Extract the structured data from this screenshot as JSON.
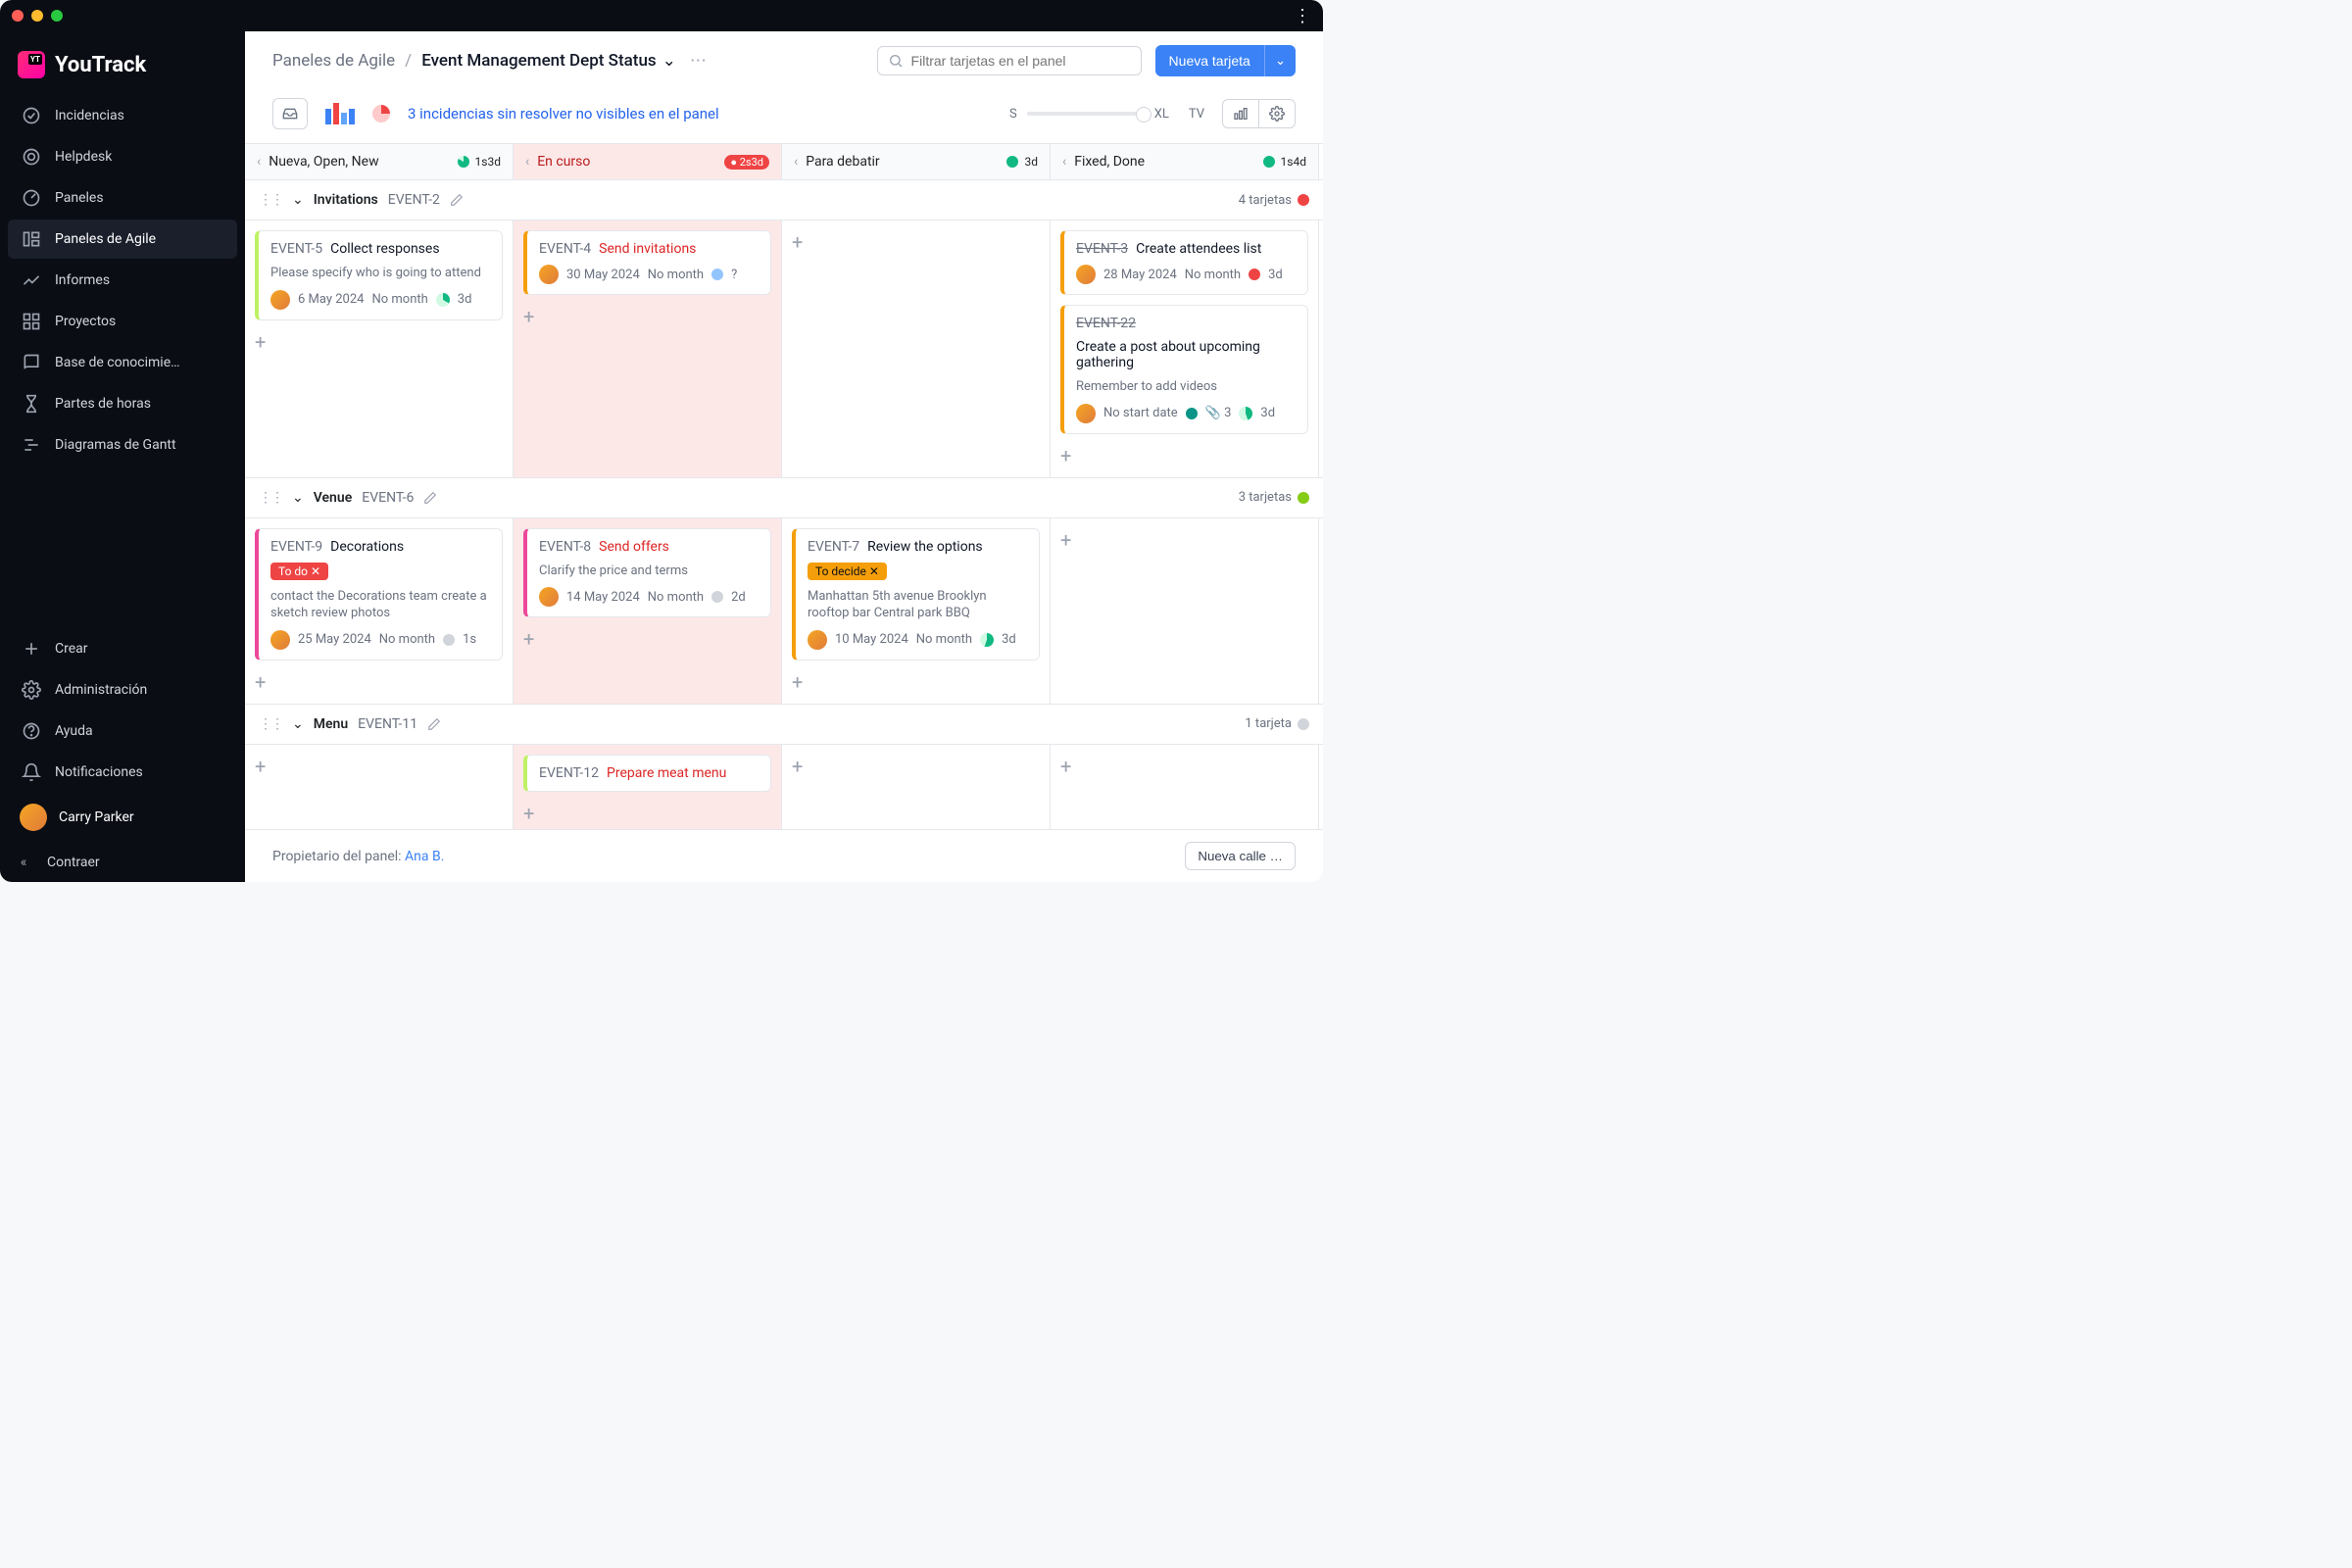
{
  "brand": "YouTrack",
  "sidebar": {
    "items": [
      {
        "label": "Incidencias",
        "icon": "check-circle-icon"
      },
      {
        "label": "Helpdesk",
        "icon": "life-ring-icon"
      },
      {
        "label": "Paneles",
        "icon": "dashboard-icon"
      },
      {
        "label": "Paneles de Agile",
        "icon": "board-icon",
        "active": true
      },
      {
        "label": "Informes",
        "icon": "chart-icon"
      },
      {
        "label": "Proyectos",
        "icon": "grid-icon"
      },
      {
        "label": "Base de conocimie…",
        "icon": "book-icon"
      },
      {
        "label": "Partes de horas",
        "icon": "hourglass-icon"
      },
      {
        "label": "Diagramas de Gantt",
        "icon": "gantt-icon"
      }
    ],
    "bottom": [
      {
        "label": "Crear",
        "icon": "plus-icon"
      },
      {
        "label": "Administración",
        "icon": "gear-icon"
      },
      {
        "label": "Ayuda",
        "icon": "help-icon"
      },
      {
        "label": "Notificaciones",
        "icon": "bell-icon"
      }
    ],
    "user": "Carry Parker",
    "collapse": "Contraer"
  },
  "header": {
    "breadcrumb_parent": "Paneles de Agile",
    "breadcrumb_current": "Event Management Dept Status",
    "search_placeholder": "Filtrar tarjetas en el panel",
    "new_card": "Nueva tarjeta"
  },
  "subbar": {
    "warning": "3 incidencias sin resolver no visibles en el panel",
    "size_s": "S",
    "size_xl": "XL",
    "size_tv": "TV"
  },
  "columns": [
    {
      "title": "Nueva, Open, New",
      "badge": "1s3d",
      "badge_color": "green",
      "pink": false
    },
    {
      "title": "En curso",
      "badge": "2s3d",
      "badge_color": "red",
      "pink": true
    },
    {
      "title": "Para debatir",
      "badge": "3d",
      "badge_color": "green_dot",
      "pink": false
    },
    {
      "title": "Fixed, Done",
      "badge": "1s4d",
      "badge_color": "green_dot",
      "pink": false
    }
  ],
  "swimlanes": [
    {
      "title": "Invitations",
      "id": "EVENT-2",
      "count": "4 tarjetas",
      "count_dot": "red",
      "cells": [
        [
          {
            "id": "EVENT-5",
            "title": "Collect responses",
            "border": "#bef264",
            "desc": "Please specify who is going to attend",
            "date": "6 May 2024",
            "month": "No month",
            "pie": "conic-gradient(#10b981 0 120deg,#d1fae5 120deg 360deg)",
            "est": "3d"
          }
        ],
        [
          {
            "id": "EVENT-4",
            "title": "Send invitations",
            "title_red": true,
            "border": "#f59e0b",
            "date": "30 May 2024",
            "month": "No month",
            "dot": "#93c5fd",
            "est": "?"
          }
        ],
        [],
        [
          {
            "id": "EVENT-3",
            "strike": true,
            "title": "Create attendees list",
            "border": "#f59e0b",
            "date": "28 May 2024",
            "month": "No month",
            "dot": "#ef4444",
            "est": "3d"
          },
          {
            "id": "EVENT-22",
            "strike": true,
            "title": "Create a post about upcoming gathering",
            "border": "#f59e0b",
            "desc": "Remember to add videos",
            "date": "No start date",
            "dot2": "#0d9488",
            "attach": "3",
            "pie": "conic-gradient(#10b981 0 160deg,#d1fae5 160deg 360deg)",
            "est": "3d"
          }
        ]
      ]
    },
    {
      "title": "Venue",
      "id": "EVENT-6",
      "count": "3 tarjetas",
      "count_dot": "lime",
      "cells": [
        [
          {
            "id": "EVENT-9",
            "title": "Decorations",
            "border": "#ec4899",
            "tag": {
              "text": "To do ✕",
              "class": "red"
            },
            "desc": "contact the Decorations team create a sketch review photos",
            "date": "25 May 2024",
            "month": "No month",
            "dot": "#d1d5db",
            "est": "1s"
          }
        ],
        [
          {
            "id": "EVENT-8",
            "title": "Send offers",
            "title_red": true,
            "border": "#ec4899",
            "desc": "Clarify the price and terms",
            "date": "14 May 2024",
            "month": "No month",
            "dot": "#d1d5db",
            "est": "2d"
          }
        ],
        [
          {
            "id": "EVENT-7",
            "title": "Review the options",
            "border": "#f59e0b",
            "tag": {
              "text": "To decide ✕",
              "class": "amber"
            },
            "desc": "Manhattan 5th avenue Brooklyn rooftop bar Central park BBQ",
            "date": "10 May 2024",
            "month": "No month",
            "pie": "conic-gradient(#10b981 0 200deg,#d1fae5 200deg 360deg)",
            "est": "3d"
          }
        ],
        []
      ]
    },
    {
      "title": "Menu",
      "id": "EVENT-11",
      "count": "1 tarjeta",
      "count_dot": "grey",
      "cells": [
        [],
        [
          {
            "id": "EVENT-12",
            "title": "Prepare meat menu",
            "title_red": true,
            "border": "#bef264"
          }
        ],
        [],
        []
      ]
    }
  ],
  "footer": {
    "owner_label": "Propietario del panel: ",
    "owner_name": "Ana B.",
    "new_column": "Nueva calle …"
  }
}
